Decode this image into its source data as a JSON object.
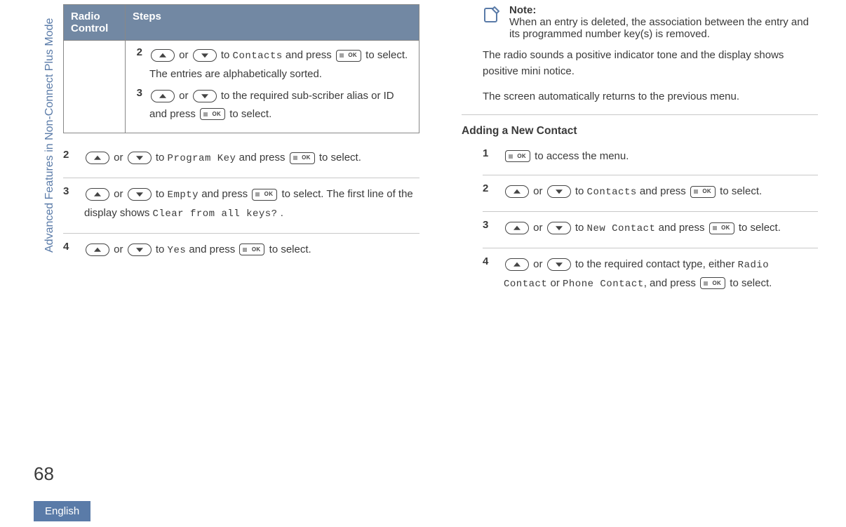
{
  "sidebar": {
    "vertical_title": "Advanced Features in Non-Connect Plus Mode",
    "page_number": "68",
    "language": "English"
  },
  "left": {
    "table": {
      "headers": {
        "col1": "Radio Control",
        "col2": "Steps"
      },
      "row": {
        "step2": {
          "num": "2",
          "pre": " or ",
          "mid1": " to ",
          "code1": "Contacts",
          "mid2": " and press ",
          "tail": " to select. The entries are alphabetically sorted."
        },
        "step3": {
          "num": "3",
          "pre": " or ",
          "mid1": " to the required sub-scriber alias or ID and press ",
          "tail": " to select."
        }
      }
    },
    "steps": {
      "s2": {
        "num": "2",
        "or": " or ",
        "to": " to ",
        "code": "Program Key",
        "andpress": " and press ",
        "tail": " to select."
      },
      "s3": {
        "num": "3",
        "or": " or ",
        "to": " to ",
        "code": "Empty",
        "andpress": " and press ",
        "tail": " to select. The first line of the display shows ",
        "code2": "Clear from all keys?",
        "dot": " ."
      },
      "s4": {
        "num": "4",
        "or": " or ",
        "to": " to ",
        "code": "Yes",
        "andpress": " and press ",
        "tail": " to select."
      }
    }
  },
  "right": {
    "note": {
      "title": "Note:",
      "body": "When an entry is deleted, the association between the entry and its programmed number key(s) is removed."
    },
    "para1": "The radio sounds a positive indicator tone and the display shows positive mini notice.",
    "para2": "The screen automatically returns to the previous menu.",
    "heading": "Adding a New Contact",
    "steps": {
      "s1": {
        "num": "1",
        "tail": " to access the menu."
      },
      "s2": {
        "num": "2",
        "or": " or ",
        "to": " to ",
        "code": "Contacts",
        "andpress": " and press ",
        "tail": " to select."
      },
      "s3": {
        "num": "3",
        "or": " or ",
        "to": " to ",
        "code": "New Contact",
        "andpress": " and press ",
        "tail": " to select."
      },
      "s4": {
        "num": "4",
        "or": " or ",
        "to": " to the required contact type, either ",
        "code1": "Radio Contact",
        "orword": " or ",
        "code2": "Phone Contact",
        "andpress": ", and press ",
        "tail": " to select."
      }
    }
  }
}
